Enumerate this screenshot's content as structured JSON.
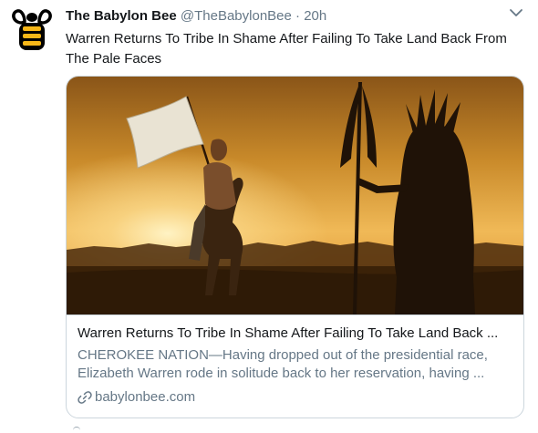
{
  "tweet": {
    "display_name": "The Babylon Bee",
    "handle": "@TheBabylonBee",
    "separator": "·",
    "time": "20h",
    "avatar_icon": "bee-logo-icon",
    "more_icon": "chevron-down-icon",
    "text": "Warren Returns To Tribe In Shame After Failing To Take Land Back From The Pale Faces"
  },
  "card": {
    "title": "Warren Returns To Tribe In Shame After Failing To Take Land Back ...",
    "description": "CHEROKEE NATION—Having dropped out of the presidential race, Elizabeth Warren rode in solitude back to her reservation, having ...",
    "domain": "babylonbee.com",
    "link_icon": "link-icon"
  },
  "colors": {
    "text": "#14171a",
    "secondary": "#657786",
    "border": "#ccd6dd",
    "sunset_top": "#a86b1e",
    "sunset_glow": "#fbd98a"
  }
}
